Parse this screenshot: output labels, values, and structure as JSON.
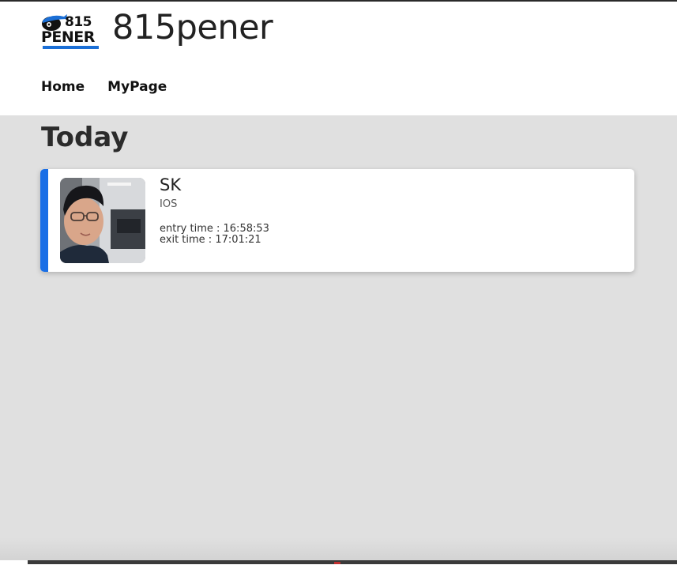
{
  "header": {
    "logo_number": "815",
    "logo_word": "PENER",
    "site_title": "815pener"
  },
  "nav": {
    "items": [
      {
        "label": "Home"
      },
      {
        "label": "MyPage"
      }
    ]
  },
  "main": {
    "section_title": "Today",
    "card": {
      "name": "SK",
      "platform": "IOS",
      "entry_time": "entry time : 16:58:53",
      "exit_time": "exit time : 17:01:21"
    }
  },
  "colors": {
    "accent": "#1a6fe6",
    "page_background": "#e0e0e0",
    "header_background": "#ffffff"
  }
}
